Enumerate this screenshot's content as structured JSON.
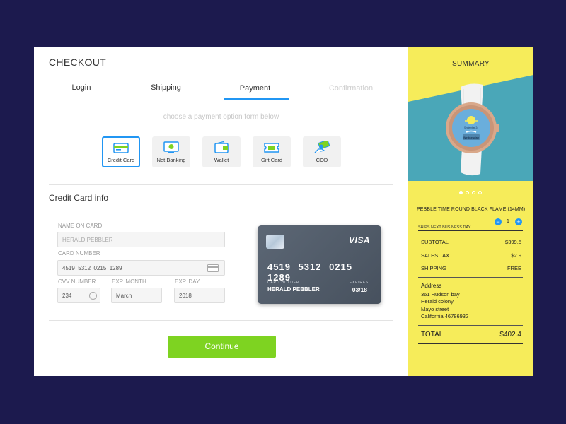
{
  "checkout": {
    "title": "CHECKOUT",
    "tabs": [
      {
        "label": "Login"
      },
      {
        "label": "Shipping"
      },
      {
        "label": "Payment"
      },
      {
        "label": "Confirmation"
      }
    ],
    "active_tab": "Payment",
    "hint": "choose a payment option form below",
    "payment_options": [
      {
        "label": "Credit Card",
        "icon": "credit-card-icon"
      },
      {
        "label": "Net Banking",
        "icon": "monitor-icon"
      },
      {
        "label": "Wallet",
        "icon": "wallet-icon"
      },
      {
        "label": "Gift Card",
        "icon": "gift-card-icon"
      },
      {
        "label": "COD",
        "icon": "cash-icon"
      }
    ],
    "selected_option": "Credit Card",
    "section_title": "Credit Card info",
    "form": {
      "name_label": "NAME ON CARD",
      "name_value": "HERALD PEBBLER",
      "number_label": "CARD NUMBER",
      "number_value": "4519  5312  0215  1289",
      "cvv_label": "CVV NUMBER",
      "cvv_value": "234",
      "month_label": "EXP. MONTH",
      "month_value": "March",
      "day_label": "EXP. DAY",
      "day_value": "2018"
    },
    "card_preview": {
      "brand": "VISA",
      "number": "4519 5312 0215 1289",
      "holder_label": "CARD HOLDER",
      "holder": "HERALD PEBBLER",
      "expires_label": "EXPIRES",
      "expires": "03/18"
    },
    "continue_label": "Continue"
  },
  "summary": {
    "title": "SUMMARY",
    "watch_face_line1": "September 24",
    "watch_face_line2": "Wednesday",
    "product_name": "PEBBLE TIME ROUND BLACK FLAME (14MM)",
    "quantity": "1",
    "ship_note": "SHIPS NEXT BUSINESS DAY",
    "rows": [
      {
        "label": "SUBTOTAL",
        "value": "$399.5"
      },
      {
        "label": "SALES TAX",
        "value": "$2.9"
      },
      {
        "label": "SHIPPING",
        "value": "FREE"
      }
    ],
    "address_heading": "Address",
    "address_lines": [
      "361 Hudson bay",
      "Herald colony",
      "Mayo street",
      "California 46786932"
    ],
    "total_label": "TOTAL",
    "total_value": "$402.4"
  },
  "colors": {
    "background": "#1c1a4e",
    "accent": "#2196f3",
    "summary_bg": "#f6ec5a",
    "teal": "#4aa7b8",
    "continue": "#7ed321"
  }
}
